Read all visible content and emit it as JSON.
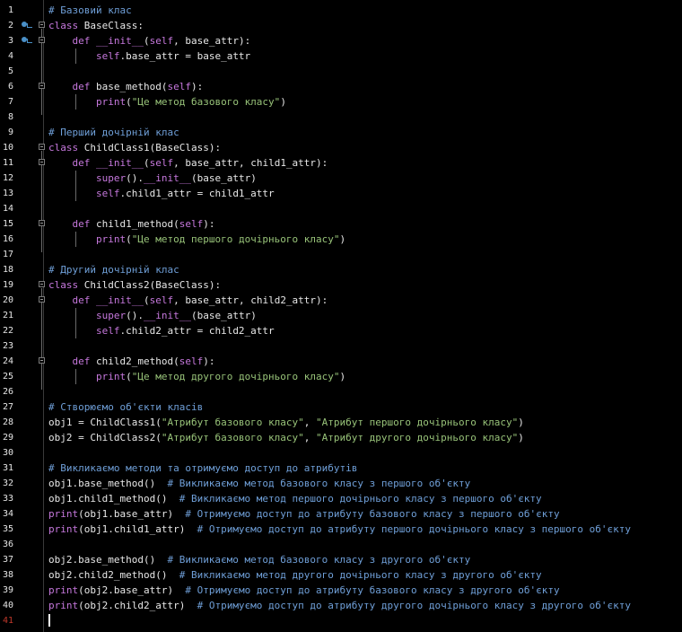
{
  "editor": {
    "current_line": 41,
    "colors": {
      "background": "#000000",
      "keyword": "#c678dd",
      "comment": "#6f9fd8",
      "string": "#98c379",
      "text": "#e8e8e8",
      "current_line_number": "#c0392b",
      "breakpoint_marker": "#4a90c8"
    },
    "lines": [
      {
        "n": "1",
        "marker": false,
        "fold": false,
        "tokens": [
          {
            "t": "cm",
            "v": "# Базовий клас"
          }
        ]
      },
      {
        "n": "2",
        "marker": true,
        "fold": true,
        "tokens": [
          {
            "t": "kw",
            "v": "class"
          },
          {
            "t": "tx",
            "v": " BaseClass:"
          }
        ]
      },
      {
        "n": "3",
        "marker": true,
        "fold": true,
        "tokens": [
          {
            "t": "tx",
            "v": "    "
          },
          {
            "t": "kw",
            "v": "def"
          },
          {
            "t": "tx",
            "v": " "
          },
          {
            "t": "sf",
            "v": "__init__"
          },
          {
            "t": "tx",
            "v": "("
          },
          {
            "t": "sf",
            "v": "self"
          },
          {
            "t": "tx",
            "v": ", base_attr):"
          }
        ]
      },
      {
        "n": "4",
        "marker": false,
        "fold": false,
        "tokens": [
          {
            "t": "tx",
            "v": "        "
          },
          {
            "t": "sf",
            "v": "self"
          },
          {
            "t": "tx",
            "v": ".base_attr = base_attr"
          }
        ]
      },
      {
        "n": "5",
        "marker": false,
        "fold": false,
        "tokens": []
      },
      {
        "n": "6",
        "marker": false,
        "fold": true,
        "tokens": [
          {
            "t": "tx",
            "v": "    "
          },
          {
            "t": "kw",
            "v": "def"
          },
          {
            "t": "tx",
            "v": " base_method("
          },
          {
            "t": "sf",
            "v": "self"
          },
          {
            "t": "tx",
            "v": "):"
          }
        ]
      },
      {
        "n": "7",
        "marker": false,
        "fold": false,
        "tokens": [
          {
            "t": "tx",
            "v": "        "
          },
          {
            "t": "bi",
            "v": "print"
          },
          {
            "t": "tx",
            "v": "("
          },
          {
            "t": "st",
            "v": "\"Це метод базового класу\""
          },
          {
            "t": "tx",
            "v": ")"
          }
        ]
      },
      {
        "n": "8",
        "marker": false,
        "fold": false,
        "tokens": []
      },
      {
        "n": "9",
        "marker": false,
        "fold": false,
        "tokens": [
          {
            "t": "cm",
            "v": "# Перший дочірній клас"
          }
        ]
      },
      {
        "n": "10",
        "marker": false,
        "fold": true,
        "tokens": [
          {
            "t": "kw",
            "v": "class"
          },
          {
            "t": "tx",
            "v": " ChildClass1(BaseClass):"
          }
        ]
      },
      {
        "n": "11",
        "marker": false,
        "fold": true,
        "tokens": [
          {
            "t": "tx",
            "v": "    "
          },
          {
            "t": "kw",
            "v": "def"
          },
          {
            "t": "tx",
            "v": " "
          },
          {
            "t": "sf",
            "v": "__init__"
          },
          {
            "t": "tx",
            "v": "("
          },
          {
            "t": "sf",
            "v": "self"
          },
          {
            "t": "tx",
            "v": ", base_attr, child1_attr):"
          }
        ]
      },
      {
        "n": "12",
        "marker": false,
        "fold": false,
        "tokens": [
          {
            "t": "tx",
            "v": "        "
          },
          {
            "t": "bi",
            "v": "super"
          },
          {
            "t": "tx",
            "v": "()."
          },
          {
            "t": "sf",
            "v": "__init__"
          },
          {
            "t": "tx",
            "v": "(base_attr)"
          }
        ]
      },
      {
        "n": "13",
        "marker": false,
        "fold": false,
        "tokens": [
          {
            "t": "tx",
            "v": "        "
          },
          {
            "t": "sf",
            "v": "self"
          },
          {
            "t": "tx",
            "v": ".child1_attr = child1_attr"
          }
        ]
      },
      {
        "n": "14",
        "marker": false,
        "fold": false,
        "tokens": []
      },
      {
        "n": "15",
        "marker": false,
        "fold": true,
        "tokens": [
          {
            "t": "tx",
            "v": "    "
          },
          {
            "t": "kw",
            "v": "def"
          },
          {
            "t": "tx",
            "v": " child1_method("
          },
          {
            "t": "sf",
            "v": "self"
          },
          {
            "t": "tx",
            "v": "):"
          }
        ]
      },
      {
        "n": "16",
        "marker": false,
        "fold": false,
        "tokens": [
          {
            "t": "tx",
            "v": "        "
          },
          {
            "t": "bi",
            "v": "print"
          },
          {
            "t": "tx",
            "v": "("
          },
          {
            "t": "st",
            "v": "\"Це метод першого дочірнього класу\""
          },
          {
            "t": "tx",
            "v": ")"
          }
        ]
      },
      {
        "n": "17",
        "marker": false,
        "fold": false,
        "tokens": []
      },
      {
        "n": "18",
        "marker": false,
        "fold": false,
        "tokens": [
          {
            "t": "cm",
            "v": "# Другий дочірній клас"
          }
        ]
      },
      {
        "n": "19",
        "marker": false,
        "fold": true,
        "tokens": [
          {
            "t": "kw",
            "v": "class"
          },
          {
            "t": "tx",
            "v": " ChildClass2(BaseClass):"
          }
        ]
      },
      {
        "n": "20",
        "marker": false,
        "fold": true,
        "tokens": [
          {
            "t": "tx",
            "v": "    "
          },
          {
            "t": "kw",
            "v": "def"
          },
          {
            "t": "tx",
            "v": " "
          },
          {
            "t": "sf",
            "v": "__init__"
          },
          {
            "t": "tx",
            "v": "("
          },
          {
            "t": "sf",
            "v": "self"
          },
          {
            "t": "tx",
            "v": ", base_attr, child2_attr):"
          }
        ]
      },
      {
        "n": "21",
        "marker": false,
        "fold": false,
        "tokens": [
          {
            "t": "tx",
            "v": "        "
          },
          {
            "t": "bi",
            "v": "super"
          },
          {
            "t": "tx",
            "v": "()."
          },
          {
            "t": "sf",
            "v": "__init__"
          },
          {
            "t": "tx",
            "v": "(base_attr)"
          }
        ]
      },
      {
        "n": "22",
        "marker": false,
        "fold": false,
        "tokens": [
          {
            "t": "tx",
            "v": "        "
          },
          {
            "t": "sf",
            "v": "self"
          },
          {
            "t": "tx",
            "v": ".child2_attr = child2_attr"
          }
        ]
      },
      {
        "n": "23",
        "marker": false,
        "fold": false,
        "tokens": []
      },
      {
        "n": "24",
        "marker": false,
        "fold": true,
        "tokens": [
          {
            "t": "tx",
            "v": "    "
          },
          {
            "t": "kw",
            "v": "def"
          },
          {
            "t": "tx",
            "v": " child2_method("
          },
          {
            "t": "sf",
            "v": "self"
          },
          {
            "t": "tx",
            "v": "):"
          }
        ]
      },
      {
        "n": "25",
        "marker": false,
        "fold": false,
        "tokens": [
          {
            "t": "tx",
            "v": "        "
          },
          {
            "t": "bi",
            "v": "print"
          },
          {
            "t": "tx",
            "v": "("
          },
          {
            "t": "st",
            "v": "\"Це метод другого дочірнього класу\""
          },
          {
            "t": "tx",
            "v": ")"
          }
        ]
      },
      {
        "n": "26",
        "marker": false,
        "fold": false,
        "tokens": []
      },
      {
        "n": "27",
        "marker": false,
        "fold": false,
        "tokens": [
          {
            "t": "cm",
            "v": "# Створюємо об'єкти класів"
          }
        ]
      },
      {
        "n": "28",
        "marker": false,
        "fold": false,
        "tokens": [
          {
            "t": "tx",
            "v": "obj1 = ChildClass1("
          },
          {
            "t": "st",
            "v": "\"Атрибут базового класу\""
          },
          {
            "t": "tx",
            "v": ", "
          },
          {
            "t": "st",
            "v": "\"Атрибут першого дочірнього класу\""
          },
          {
            "t": "tx",
            "v": ")"
          }
        ]
      },
      {
        "n": "29",
        "marker": false,
        "fold": false,
        "tokens": [
          {
            "t": "tx",
            "v": "obj2 = ChildClass2("
          },
          {
            "t": "st",
            "v": "\"Атрибут базового класу\""
          },
          {
            "t": "tx",
            "v": ", "
          },
          {
            "t": "st",
            "v": "\"Атрибут другого дочірнього класу\""
          },
          {
            "t": "tx",
            "v": ")"
          }
        ]
      },
      {
        "n": "30",
        "marker": false,
        "fold": false,
        "tokens": []
      },
      {
        "n": "31",
        "marker": false,
        "fold": false,
        "tokens": [
          {
            "t": "cm",
            "v": "# Викликаємо методи та отримуємо доступ до атрибутів"
          }
        ]
      },
      {
        "n": "32",
        "marker": false,
        "fold": false,
        "tokens": [
          {
            "t": "tx",
            "v": "obj1.base_method()  "
          },
          {
            "t": "cm",
            "v": "# Викликаємо метод базового класу з першого об'єкту"
          }
        ]
      },
      {
        "n": "33",
        "marker": false,
        "fold": false,
        "tokens": [
          {
            "t": "tx",
            "v": "obj1.child1_method()  "
          },
          {
            "t": "cm",
            "v": "# Викликаємо метод першого дочірнього класу з першого об'єкту"
          }
        ]
      },
      {
        "n": "34",
        "marker": false,
        "fold": false,
        "tokens": [
          {
            "t": "bi",
            "v": "print"
          },
          {
            "t": "tx",
            "v": "(obj1.base_attr)  "
          },
          {
            "t": "cm",
            "v": "# Отримуємо доступ до атрибуту базового класу з першого об'єкту"
          }
        ]
      },
      {
        "n": "35",
        "marker": false,
        "fold": false,
        "tokens": [
          {
            "t": "bi",
            "v": "print"
          },
          {
            "t": "tx",
            "v": "(obj1.child1_attr)  "
          },
          {
            "t": "cm",
            "v": "# Отримуємо доступ до атрибуту першого дочірнього класу з першого об'єкту"
          }
        ]
      },
      {
        "n": "36",
        "marker": false,
        "fold": false,
        "tokens": []
      },
      {
        "n": "37",
        "marker": false,
        "fold": false,
        "tokens": [
          {
            "t": "tx",
            "v": "obj2.base_method()  "
          },
          {
            "t": "cm",
            "v": "# Викликаємо метод базового класу з другого об'єкту"
          }
        ]
      },
      {
        "n": "38",
        "marker": false,
        "fold": false,
        "tokens": [
          {
            "t": "tx",
            "v": "obj2.child2_method()  "
          },
          {
            "t": "cm",
            "v": "# Викликаємо метод другого дочірнього класу з другого об'єкту"
          }
        ]
      },
      {
        "n": "39",
        "marker": false,
        "fold": false,
        "tokens": [
          {
            "t": "bi",
            "v": "print"
          },
          {
            "t": "tx",
            "v": "(obj2.base_attr)  "
          },
          {
            "t": "cm",
            "v": "# Отримуємо доступ до атрибуту базового класу з другого об'єкту"
          }
        ]
      },
      {
        "n": "40",
        "marker": false,
        "fold": false,
        "tokens": [
          {
            "t": "bi",
            "v": "print"
          },
          {
            "t": "tx",
            "v": "(obj2.child2_attr)  "
          },
          {
            "t": "cm",
            "v": "# Отримуємо доступ до атрибуту другого дочірнього класу з другого об'єкту"
          }
        ]
      },
      {
        "n": "41",
        "marker": false,
        "fold": false,
        "tokens": []
      }
    ]
  }
}
